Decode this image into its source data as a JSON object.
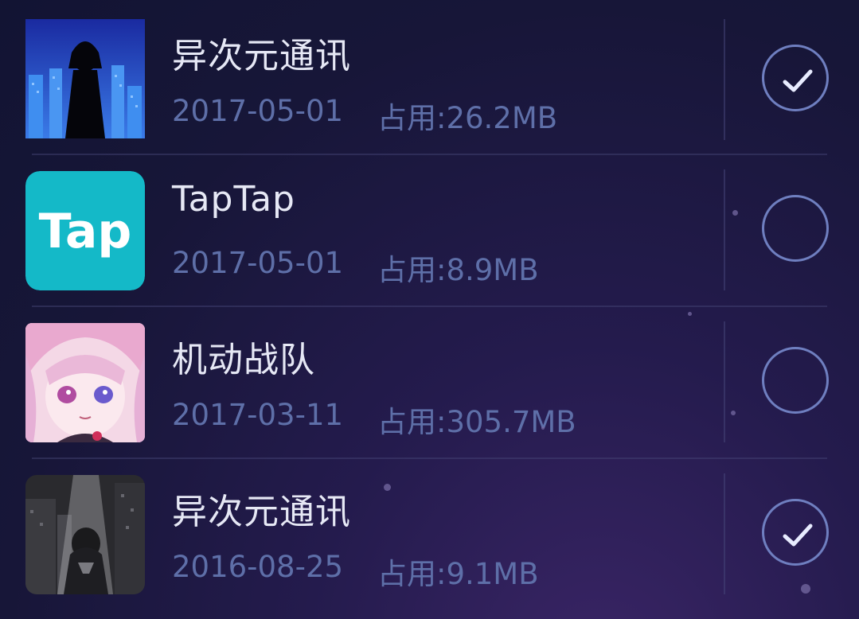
{
  "apps": [
    {
      "name": "异次元通讯",
      "date": "2017-05-01",
      "size": "占用:26.2MB",
      "selected": true,
      "icon": "silhouette-city-icon"
    },
    {
      "name": "TapTap",
      "date": "2017-05-01",
      "size": "占用:8.9MB",
      "selected": false,
      "icon": "taptap-logo-icon",
      "icon_text": "Tap",
      "icon_color": "#14b9c8"
    },
    {
      "name": "机动战队",
      "date": "2017-03-11",
      "size": "占用:305.7MB",
      "selected": false,
      "icon": "anime-girl-icon"
    },
    {
      "name": "异次元通讯",
      "date": "2016-08-25",
      "size": "占用:9.1MB",
      "selected": true,
      "icon": "dark-city-girl-icon"
    }
  ],
  "colors": {
    "background": "#171638",
    "title": "#e6e8f5",
    "meta": "#5e6fa8",
    "checkbox": "#6f7fc0"
  }
}
